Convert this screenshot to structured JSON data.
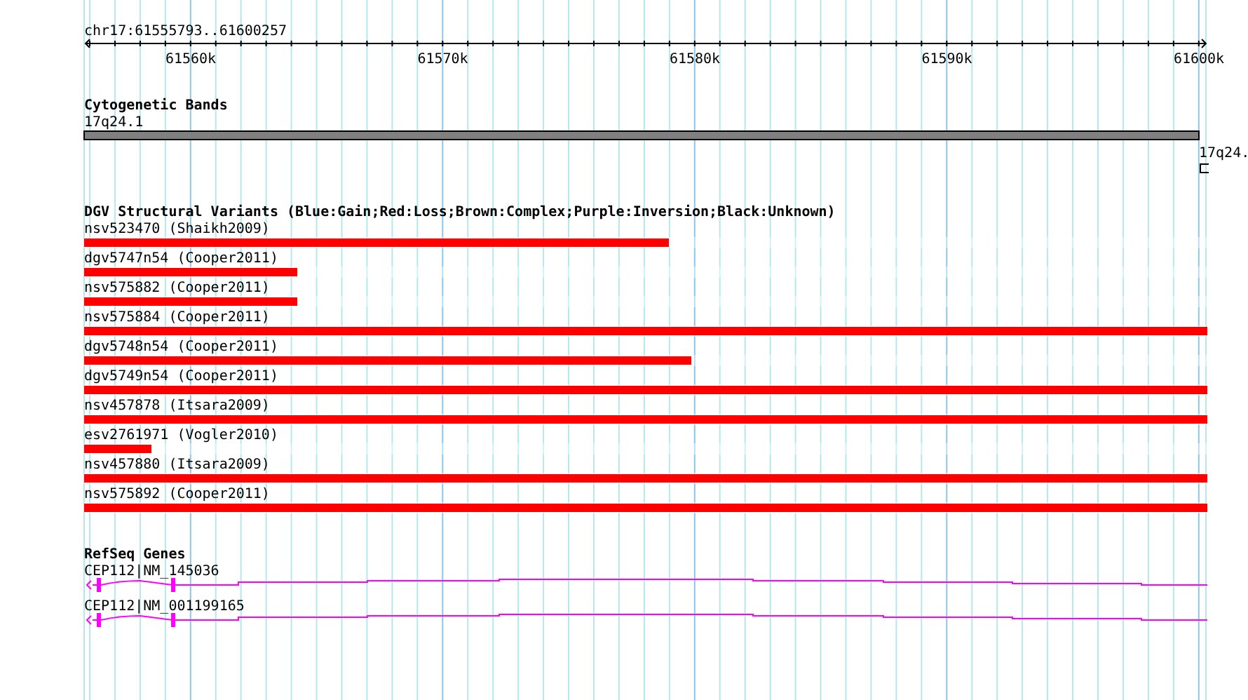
{
  "ruler": {
    "position": "chr17:61555793..61600257",
    "ticks": [
      "61560k",
      "61570k",
      "61580k",
      "61590k",
      "61600k"
    ]
  },
  "cytoband_track": {
    "title": "Cytogenetic Bands",
    "band": "17q24.1",
    "edge_label": "17q24."
  },
  "variant_track": {
    "title": "DGV Structural Variants (Blue:Gain;Red:Loss;Brown:Complex;Purple:Inversion;Black:Unknown)",
    "variants": [
      {
        "label": "nsv523470 (Shaikh2009)",
        "color": "#ff0000",
        "level": 0.52
      },
      {
        "label": "dgv5747n54 (Cooper2011)",
        "color": "#ff0000",
        "level": 0.19
      },
      {
        "label": "nsv575882 (Cooper2011)",
        "color": "#ff0000",
        "level": 0.19
      },
      {
        "label": "nsv575884 (Cooper2011)",
        "color": "#ff0000",
        "level": 1
      },
      {
        "label": "dgv5748n54 (Cooper2011)",
        "color": "#ff0000",
        "level": 0.54
      },
      {
        "label": "dgv5749n54 (Cooper2011)",
        "color": "#ff0000",
        "level": 1
      },
      {
        "label": "nsv457878 (Itsara2009)",
        "color": "#ff0000",
        "level": 1
      },
      {
        "label": "esv2761971 (Vogler2010)",
        "color": "#ff0000",
        "level": 0.06
      },
      {
        "label": "nsv457880 (Itsara2009)",
        "color": "#ff0000",
        "level": 1
      },
      {
        "label": "nsv575892 (Cooper2011)",
        "color": "#ff0000",
        "level": 1
      }
    ]
  },
  "gene_track": {
    "title": "RefSeq Genes",
    "genes": [
      {
        "label": "CEP112|NM_145036"
      },
      {
        "label": "CEP112|NM_001199165"
      }
    ]
  }
}
